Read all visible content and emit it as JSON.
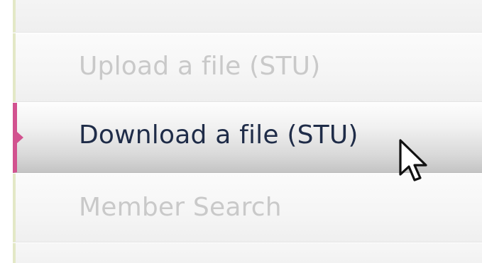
{
  "menu": {
    "items": [
      {
        "label": "Upload a file (STU)",
        "state": "inactive"
      },
      {
        "label": "Download a file (STU)",
        "state": "hover"
      },
      {
        "label": "Member Search",
        "state": "inactive"
      }
    ]
  },
  "colors": {
    "accent": "#d2528f",
    "active_text": "#1f2c48",
    "inactive_text": "#c9c9c9",
    "left_border": "#e3e8c6"
  },
  "cursor": {
    "icon": "arrow-pointer-icon"
  }
}
